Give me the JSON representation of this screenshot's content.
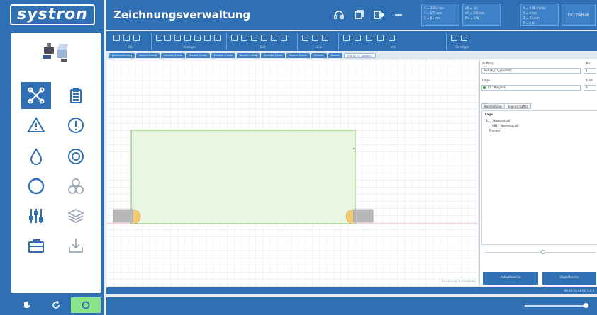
{
  "app": {
    "logo_text": "systron",
    "title": "Zeichnungsverwaltung"
  },
  "header": {
    "coords": [
      "X = 3380 mm\nY = 675 mm\nZ = 63 mm",
      "dX = -4 /\ndY = 120 mm\nPhi = 0 %",
      "X = 0 45 m/min\nY = 0 m/s\nZ = 63 mm\nP = 4 %"
    ],
    "user_label": "OK : Default"
  },
  "toolbar": {
    "groups": [
      "Ein",
      "Anzeigen",
      "Edit",
      "Linie",
      "Info",
      "Sonstiges"
    ]
  },
  "tabs": [
    "Linienzeichnung",
    "Bauteil Z-stoß",
    "Scheibe Z-stoß",
    "Bauteil Z-stoß",
    "Scheibe Z-stoß",
    "Bauteil Z-stoß",
    "Scheibe Z-stoß",
    "Bauteil Z-stoß",
    "Scheibe",
    "Bauteil",
    "PGR26_02_gesamt7"
  ],
  "active_tab": "PGR26_02_gesamt7",
  "canvas": {
    "status": "Zeichnung: 4 Elemente"
  },
  "right_panel": {
    "auftrag_label": "Auftrag",
    "auftrag_value": "PGR26_02_gesamt7",
    "nr_label": "Nr.",
    "nr_value": "1",
    "lage_label": "Lage",
    "lage_value": "L1 : Ringbox",
    "dist_label": "Dist.",
    "dist_value": "0",
    "tab_bearbeitung": "Bearbeitung",
    "tab_eigenschaften": "Eigenschaften",
    "tree_header": "Lage",
    "tree_items": [
      "L1 : Wasserstrahl",
      "SB1 : Wasserstrahl",
      "Formen"
    ],
    "btn_aktualisieren": "Aktualisieren",
    "btn_exportieren": "Exportieren"
  },
  "status_bar": {
    "text": "00:43:52,44 OL 1,0.6"
  },
  "colors": {
    "primary": "#2f6fb3",
    "shape_fill": "#e9f6e2",
    "shape_stroke": "#7fc46a",
    "baseline": "#f4b0b0",
    "part_fill": "#b8b8b8",
    "part_accent": "#f3c873",
    "active_green": "#8be48b"
  }
}
